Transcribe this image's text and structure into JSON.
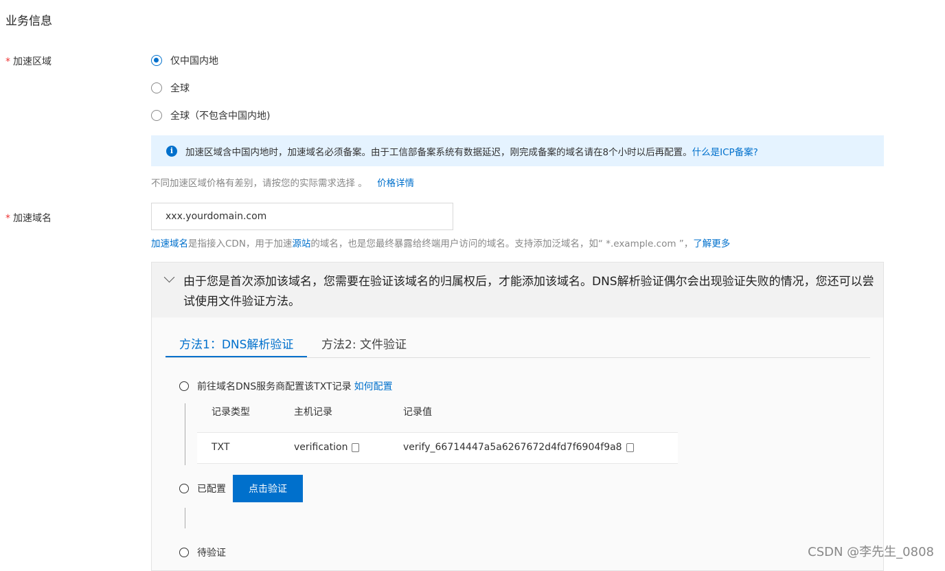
{
  "section_title": "业务信息",
  "region": {
    "required_mark": "*",
    "label": "加速区域",
    "options": [
      {
        "label": "仅中国内地",
        "checked": true
      },
      {
        "label": "全球",
        "checked": false
      },
      {
        "label": "全球（不包含中国内地)",
        "checked": false
      }
    ],
    "notice": {
      "icon": "info-icon",
      "icon_glyph": "i",
      "text": "加速区域含中国内地时，加速域名必须备案。由于工信部备案系统有数据延迟，刚完成备案的域名请在8个小时以后再配置。",
      "link": "什么是ICP备案?"
    },
    "price_hint": "不同加速区域价格有差别，请按您的实际需求选择 。",
    "price_link": "价格详情"
  },
  "domain": {
    "required_mark": "*",
    "label": "加速域名",
    "input_value": "xxx.yourdomain.com",
    "desc_link1": "加速域名",
    "desc_text1": "是指接入CDN，用于加速",
    "desc_link2": "源站",
    "desc_text2": "的域名，也是您最终暴露给终端用户访问的域名。支持添加泛域名，如“ *.example.com ”，",
    "desc_link3": "了解更多"
  },
  "verify": {
    "collapse_icon": "chevron-down-icon",
    "message": "由于您是首次添加该域名，您需要在验证该域名的归属权后，才能添加该域名。DNS解析验证偶尔会出现验证失败的情况，您还可以尝试使用文件验证方法。",
    "tabs": [
      {
        "label": "方法1：DNS解析验证",
        "active": true
      },
      {
        "label": "方法2: 文件验证",
        "active": false
      }
    ],
    "step1_text": "前往域名DNS服务商配置该TXT记录",
    "step1_link": "如何配置",
    "table": {
      "headers": [
        "记录类型",
        "主机记录",
        "记录值"
      ],
      "row": {
        "type": "TXT",
        "host": "verification",
        "value": "verify_66714447a5a6267672d4fd7f6904f9a8"
      }
    },
    "copy_icon": "copy-icon",
    "step2_text": "已配置",
    "verify_button": "点击验证",
    "step3_text": "待验证"
  },
  "watermark": "CSDN @李先生_0808",
  "colors": {
    "accent": "#0070cc",
    "info_bg": "#e5f3ff",
    "required": "#e33333"
  }
}
